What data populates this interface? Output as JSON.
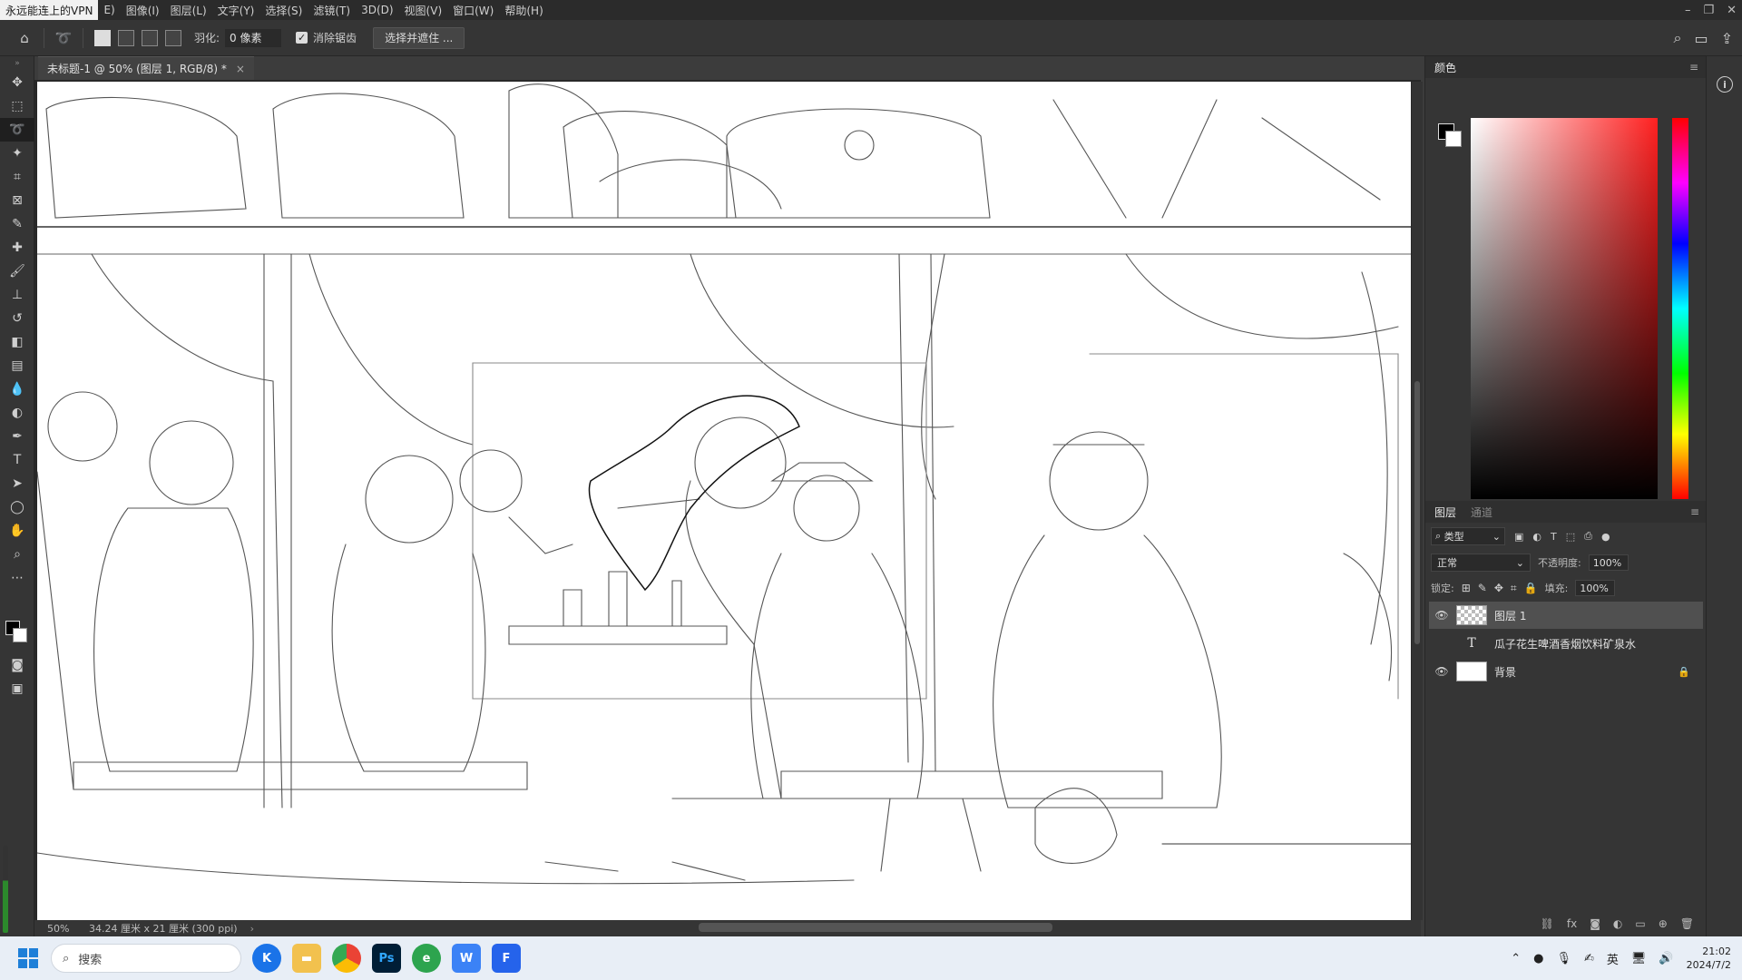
{
  "menubar": {
    "vpn_label": "永远能连上的VPN",
    "items": [
      "E)",
      "图像(I)",
      "图层(L)",
      "文字(Y)",
      "选择(S)",
      "滤镜(T)",
      "3D(D)",
      "视图(V)",
      "窗口(W)",
      "帮助(H)"
    ]
  },
  "options": {
    "feather_label": "羽化:",
    "feather_value": "0 像素",
    "antialias_label": "消除锯齿",
    "select_mask_label": "选择并遮住 ..."
  },
  "document": {
    "tab_title": "未标题-1 @ 50% (图层 1, RGB/8) *",
    "close_glyph": "×"
  },
  "status": {
    "zoom": "50%",
    "doc_info": "34.24 厘米 x 21 厘米 (300 ppi)"
  },
  "color_panel": {
    "tab_label": "颜色",
    "foreground": "#000000",
    "background": "#ffffff"
  },
  "layers_panel": {
    "tabs": [
      "图层",
      "通道"
    ],
    "filter_label": "类型",
    "blend_mode": "正常",
    "opacity_label": "不透明度:",
    "opacity_value": "100%",
    "lock_label": "锁定:",
    "fill_label": "填充:",
    "fill_value": "100%",
    "layers": [
      {
        "name": "图层 1",
        "type": "pixel",
        "visible": true,
        "selected": true
      },
      {
        "name": "瓜子花生啤酒香烟饮料矿泉水",
        "type": "text",
        "visible": false,
        "selected": false
      },
      {
        "name": "背景",
        "type": "background",
        "visible": true,
        "selected": false,
        "locked": true
      }
    ]
  },
  "taskbar": {
    "search_placeholder": "搜索",
    "apps": [
      "K",
      "folder",
      "chrome",
      "Ps",
      "edge",
      "W",
      "F"
    ],
    "ime_label": "英",
    "time": "21:02",
    "date": "2024/7/2"
  }
}
